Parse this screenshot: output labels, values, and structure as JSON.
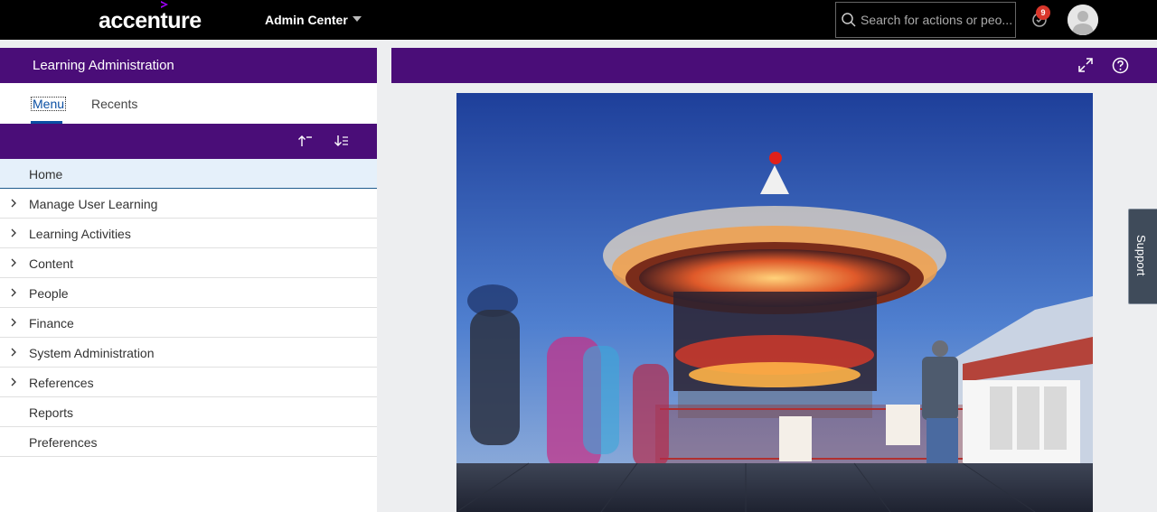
{
  "topbar": {
    "logo_text": "accenture",
    "admin_center_label": "Admin Center",
    "search_placeholder": "Search for actions or peo...",
    "notification_count": "9"
  },
  "left_panel": {
    "title": "Learning Administration",
    "tabs": [
      {
        "label": "Menu",
        "active": true
      },
      {
        "label": "Recents",
        "active": false
      }
    ],
    "toolbar": {
      "collapse_icon": "arrow-up-icon",
      "sort_icon": "sort-icon"
    },
    "nav_items": [
      {
        "label": "Home",
        "expandable": false,
        "selected": true
      },
      {
        "label": "Manage User Learning",
        "expandable": true
      },
      {
        "label": "Learning Activities",
        "expandable": true
      },
      {
        "label": "Content",
        "expandable": true
      },
      {
        "label": "People",
        "expandable": true
      },
      {
        "label": "Finance",
        "expandable": true
      },
      {
        "label": "System Administration",
        "expandable": true
      },
      {
        "label": "References",
        "expandable": true
      },
      {
        "label": "Reports",
        "expandable": false
      },
      {
        "label": "Preferences",
        "expandable": false
      }
    ]
  },
  "support": {
    "label": "Support"
  },
  "colors": {
    "brand_purple": "#4a0d78",
    "selected_bg": "#e5f0fa",
    "badge_red": "#d9362b"
  }
}
